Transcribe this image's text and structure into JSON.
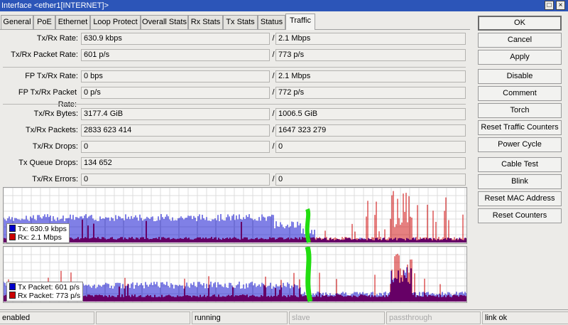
{
  "window": {
    "title": "Interface <ether1[INTERNET]>",
    "button_restore": "□",
    "button_close": "×"
  },
  "tabs": [
    {
      "label": "General"
    },
    {
      "label": "PoE"
    },
    {
      "label": "Ethernet"
    },
    {
      "label": "Loop Protect"
    },
    {
      "label": "Overall Stats"
    },
    {
      "label": "Rx Stats"
    },
    {
      "label": "Tx Stats"
    },
    {
      "label": "Status"
    },
    {
      "label": "Traffic",
      "active": true
    }
  ],
  "stats": {
    "tx_rx_rate": {
      "label": "Tx/Rx Rate:",
      "tx": "630.9 kbps",
      "rx": "2.1 Mbps"
    },
    "tx_rx_packet_rate": {
      "label": "Tx/Rx Packet Rate:",
      "tx": "601 p/s",
      "rx": "773 p/s"
    },
    "fp_tx_rx_rate": {
      "label": "FP Tx/Rx Rate:",
      "tx": "0 bps",
      "rx": "2.1 Mbps"
    },
    "fp_tx_rx_packet_rate": {
      "label": "FP Tx/Rx Packet Rate:",
      "tx": "0 p/s",
      "rx": "772 p/s"
    },
    "tx_rx_bytes": {
      "label": "Tx/Rx Bytes:",
      "tx": "3177.4 GiB",
      "rx": "1006.5 GiB"
    },
    "tx_rx_packets": {
      "label": "Tx/Rx Packets:",
      "tx": "2833 623 414",
      "rx": "1647 323 279"
    },
    "tx_rx_drops": {
      "label": "Tx/Rx Drops:",
      "tx": "0",
      "rx": "0"
    },
    "tx_queue_drops": {
      "label": "Tx Queue Drops:",
      "value": "134 652"
    },
    "tx_rx_errors": {
      "label": "Tx/Rx Errors:",
      "tx": "0",
      "rx": "0"
    },
    "slash": "/"
  },
  "graphs": {
    "traffic": {
      "legend_tx": "Tx:  630.9 kbps",
      "legend_rx": "Rx:  2.1 Mbps",
      "tx_color": "#0000cc",
      "rx_color": "#cc0000"
    },
    "packets": {
      "legend_tx": "Tx Packet:  601 p/s",
      "legend_rx": "Rx Packet:  773 p/s",
      "tx_color": "#0000cc",
      "rx_color": "#cc0000"
    },
    "grid_color": "#dcdcdc",
    "annotation_color": "#22dd11"
  },
  "buttons": {
    "ok": "OK",
    "cancel": "Cancel",
    "apply": "Apply",
    "disable": "Disable",
    "comment": "Comment",
    "torch": "Torch",
    "reset_traffic_counters": "Reset Traffic Counters",
    "power_cycle": "Power Cycle",
    "cable_test": "Cable Test",
    "blink": "Blink",
    "reset_mac_address": "Reset MAC Address",
    "reset_counters": "Reset Counters"
  },
  "status_bar": {
    "enabled": "enabled",
    "running": "running",
    "slave": "slave",
    "passthrough": "passthrough",
    "link": "link ok"
  }
}
